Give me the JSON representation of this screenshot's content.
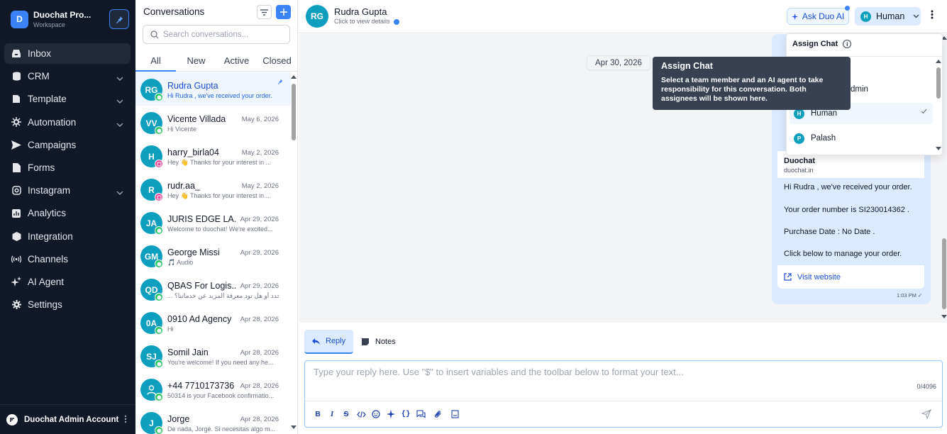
{
  "workspace": {
    "initial": "D",
    "name": "Duochat Pro...",
    "subtitle": "Workspace"
  },
  "nav": [
    {
      "label": "Inbox",
      "icon": "inbox-icon",
      "active": true,
      "has_chevron": false
    },
    {
      "label": "CRM",
      "icon": "database-icon",
      "has_chevron": true
    },
    {
      "label": "Template",
      "icon": "template-icon",
      "has_chevron": true
    },
    {
      "label": "Automation",
      "icon": "automation-icon",
      "has_chevron": true
    },
    {
      "label": "Campaigns",
      "icon": "send-icon",
      "has_chevron": false
    },
    {
      "label": "Forms",
      "icon": "form-icon",
      "has_chevron": false
    },
    {
      "label": "Instagram",
      "icon": "instagram-icon",
      "has_chevron": true
    },
    {
      "label": "Analytics",
      "icon": "chart-icon",
      "has_chevron": false
    },
    {
      "label": "Integration",
      "icon": "puzzle-icon",
      "has_chevron": false
    },
    {
      "label": "Channels",
      "icon": "broadcast-icon",
      "has_chevron": false
    },
    {
      "label": "AI Agent",
      "icon": "sparkles-icon",
      "has_chevron": false
    },
    {
      "label": "Settings",
      "icon": "gear-icon",
      "has_chevron": false
    }
  ],
  "account": {
    "name": "Duochat Admin Account"
  },
  "conversations": {
    "title": "Conversations",
    "search_placeholder": "Search conversations...",
    "tabs": [
      "All",
      "New",
      "Active",
      "Closed"
    ],
    "items": [
      {
        "initials": "RG",
        "name": "Rudra Gupta",
        "date": "",
        "preview": "Hi Rudra , we've received your order.",
        "channel": "whatsapp",
        "selected": true,
        "pinned": true
      },
      {
        "initials": "VV",
        "name": "Vicente Villada",
        "date": "May 6, 2026",
        "preview": "Hi Vicente",
        "channel": "whatsapp"
      },
      {
        "initials": "H",
        "name": "harry_birla04",
        "date": "May 2, 2026",
        "preview": "Hey 👋 Thanks for your interest in ...",
        "channel": "instagram"
      },
      {
        "initials": "R",
        "name": "rudr.aa_",
        "date": "May 2, 2026",
        "preview": "Hey 👋 Thanks for your interest in ...",
        "channel": "instagram"
      },
      {
        "initials": "JA",
        "name": "JURIS EDGE LA...",
        "date": "Apr 29, 2026",
        "preview": "Welcome to duochat! We're excited...",
        "channel": "whatsapp"
      },
      {
        "initials": "GM",
        "name": "George Missi",
        "date": "Apr 29, 2026",
        "preview": "🎵 Audio",
        "channel": "whatsapp"
      },
      {
        "initials": "QD",
        "name": "QBAS For Logis...",
        "date": "Apr 29, 2026",
        "preview": "... في شيء محدد أو هل تود معرفة المزيد عن خدماتنا؟",
        "channel": "whatsapp"
      },
      {
        "initials": "0A",
        "name": "0910 Ad Agency",
        "date": "Apr 28, 2026",
        "preview": "Hi",
        "channel": "whatsapp"
      },
      {
        "initials": "SJ",
        "name": "Somil Jain",
        "date": "Apr 28, 2026",
        "preview": "You're welcome! If you need any he...",
        "channel": "whatsapp"
      },
      {
        "initials": "",
        "name": "+44 7710173736",
        "date": "Apr 28, 2026",
        "preview": "50314 is your Facebook confirmatio...",
        "channel": "whatsapp",
        "person_icon": true
      },
      {
        "initials": "J",
        "name": "Jorge",
        "date": "Apr 28, 2026",
        "preview": "De nada, Jorge. Si necesitas algo m...",
        "channel": "whatsapp"
      }
    ]
  },
  "header": {
    "initials": "RG",
    "name": "Rudra Gupta",
    "subtitle": "Click to view details",
    "ask_duo": "Ask Duo AI",
    "assignee_initial": "H",
    "assignee": "Human"
  },
  "chat": {
    "date_chip": "Apr 30, 2026",
    "card_title": "Duochat",
    "card_url": "duochat.in",
    "lines": [
      "Hi  Rudra , we've received your order.",
      "Your order number is SI230014362 .",
      "Purchase Date : No Date .",
      "Click below to manage your order."
    ],
    "visit_label": "Visit website",
    "time": "1:03 PM"
  },
  "assign": {
    "title": "Assign Chat",
    "partial_option": "dmin",
    "options": [
      {
        "initial": "H",
        "label": "Human",
        "selected": true
      },
      {
        "initial": "P",
        "label": "Palash",
        "selected": false
      }
    ]
  },
  "tooltip": {
    "title": "Assign Chat",
    "body": "Select a team member and an AI agent to take responsibility for this conversation. Both assignees will be shown here."
  },
  "composer": {
    "tabs": [
      "Reply",
      "Notes"
    ],
    "placeholder": "Type your reply here. Use \"$\" to insert variables and the toolbar below to format your text...",
    "counter": "0/4096",
    "toolbar": [
      "bold",
      "italic",
      "strikethrough",
      "code",
      "emoji",
      "ai-sparkle",
      "variables",
      "quick-reply",
      "attachment",
      "template"
    ]
  },
  "colors": {
    "accent": "#3b82f6",
    "sidebar_bg": "#111827",
    "avatar": "#0e9fbf",
    "bubble": "#dbeafe",
    "whatsapp": "#22c55e",
    "instagram": "#ec4899"
  }
}
